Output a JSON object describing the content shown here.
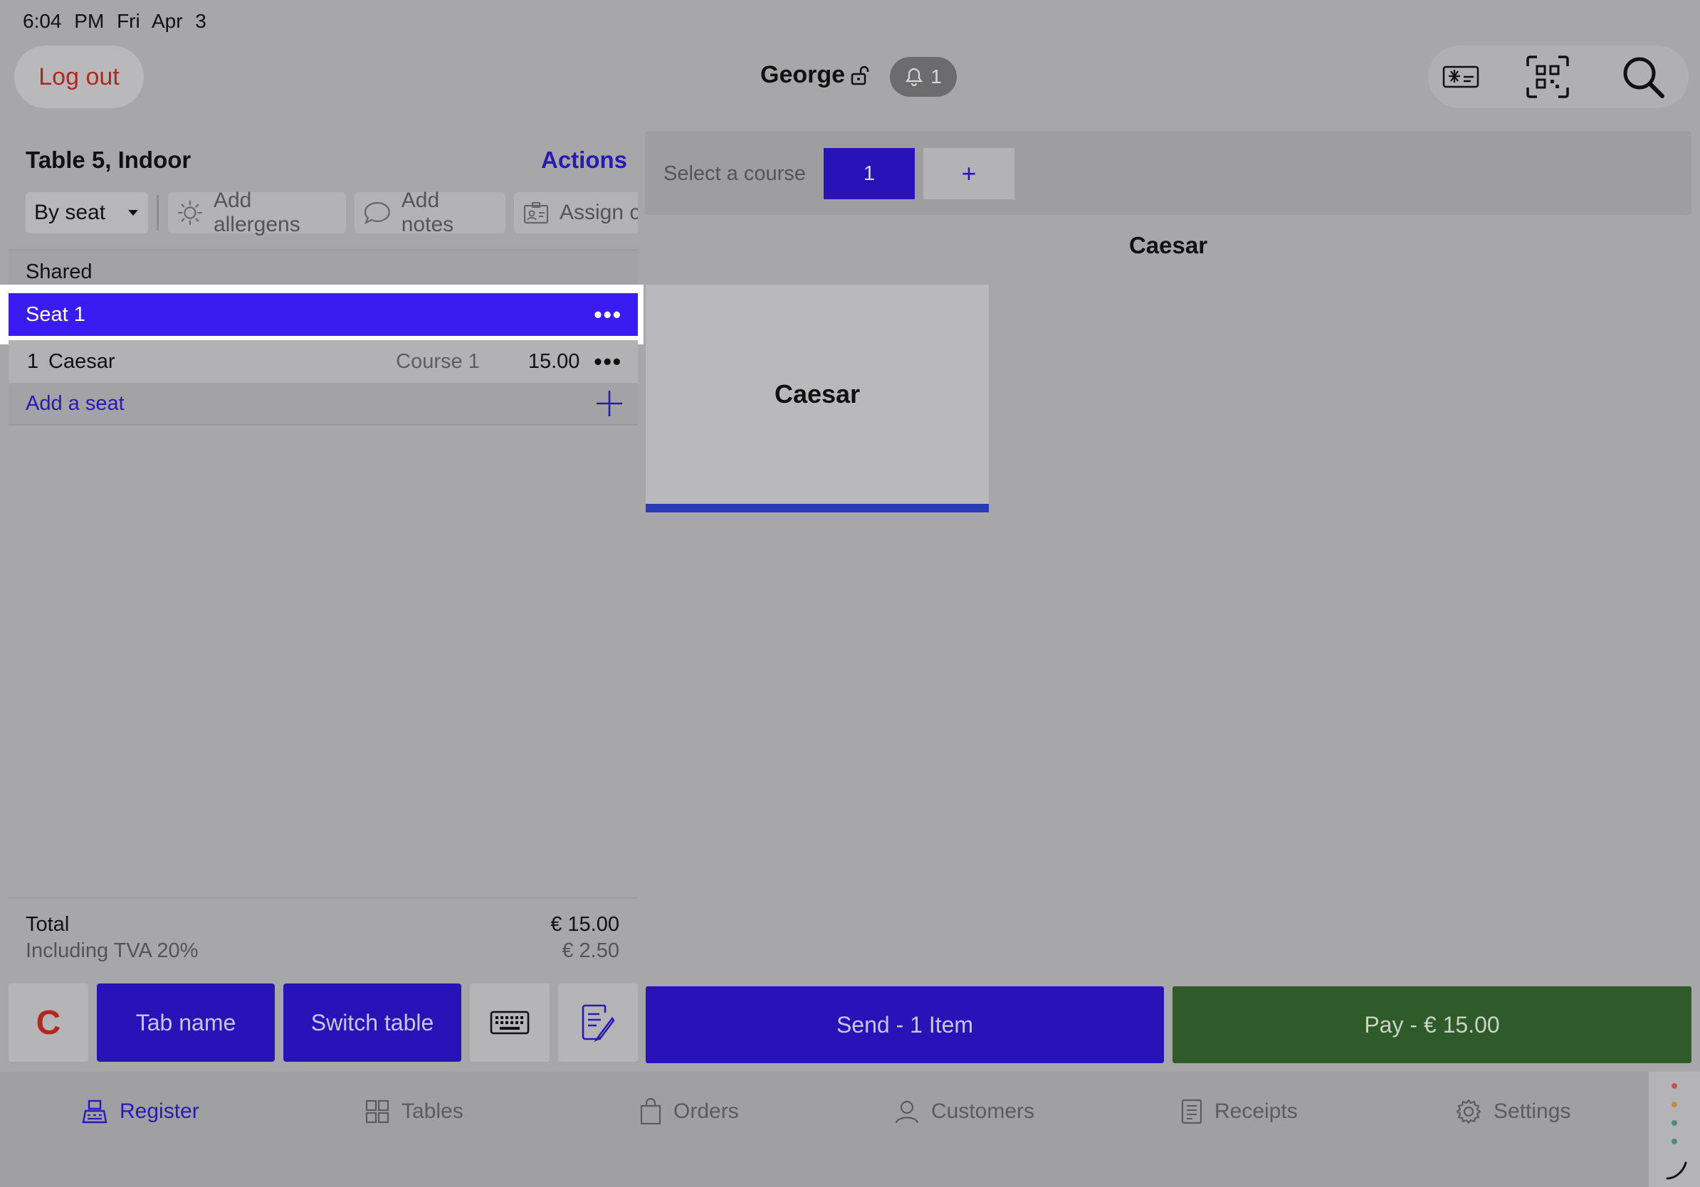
{
  "status_bar": {
    "time": "6:04 PM",
    "date": "Fri Apr 3"
  },
  "header": {
    "logout_label": "Log out",
    "user_name": "George",
    "notification_count": "1",
    "icons": [
      "card-icon",
      "qr-scan-icon",
      "search-icon"
    ]
  },
  "order": {
    "table_title": "Table 5, Indoor",
    "actions_label": "Actions",
    "view_mode": "By seat",
    "chips": {
      "allergens": "Add allergens",
      "notes": "Add notes",
      "assign": "Assign c"
    },
    "shared_label": "Shared",
    "seat_label": "Seat 1",
    "item": {
      "qty": "1",
      "name": "Caesar",
      "course": "Course 1",
      "price": "15.00"
    },
    "add_seat_label": "Add a seat"
  },
  "totals": {
    "total_label": "Total",
    "total_value": "€ 15.00",
    "tva_label": "Including TVA 20%",
    "tva_value": "€ 2.50"
  },
  "bottom_buttons": {
    "clear_label": "C",
    "tab_name_label": "Tab name",
    "switch_table_label": "Switch table"
  },
  "menu": {
    "course_label": "Select a course",
    "course_selected": "1",
    "course_add": "+",
    "category_title": "Caesar",
    "tile_label": "Caesar"
  },
  "actions": {
    "send_label": "Send - 1 Item",
    "pay_label": "Pay - € 15.00"
  },
  "tabbar": {
    "register": "Register",
    "tables": "Tables",
    "orders": "Orders",
    "customers": "Customers",
    "receipts": "Receipts",
    "settings": "Settings"
  },
  "colors": {
    "accent": "#2912b7",
    "selected_seat": "#3a1cf0",
    "pay_green": "#2f5a2a",
    "logout_red": "#b2271f"
  }
}
